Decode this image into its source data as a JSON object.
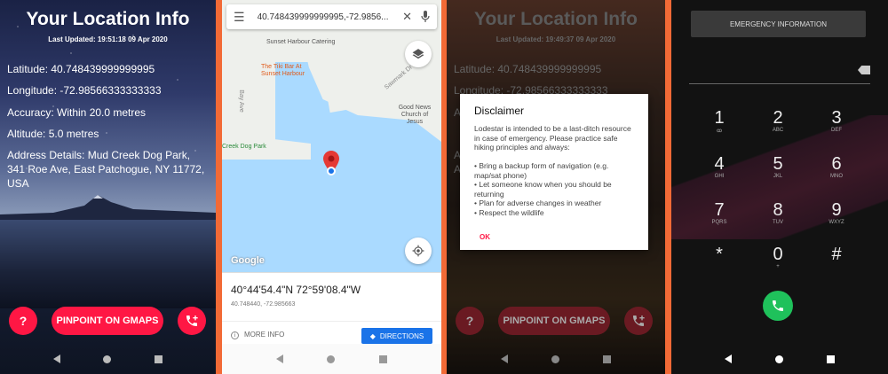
{
  "screen1": {
    "title": "Your Location Info",
    "last_updated": "Last Updated: 19:51:18 09 Apr 2020",
    "latitude": "Latitude: 40.748439999999995",
    "longitude": "Longitude: -72.98566333333333",
    "accuracy": "Accuracy: Within 20.0 metres",
    "altitude": "Altitude: 5.0 metres",
    "address": "Address Details: Mud Creek Dog Park, 341 Roe Ave, East Patchogue, NY 11772, USA",
    "help_label": "?",
    "pinpoint_label": "PINPOINT ON GMAPS"
  },
  "screen2": {
    "search_text": "40.748439999999995,-72.9856...",
    "labels": {
      "catering": "Sunset Harbour Catering",
      "tiki": "The Tiki Bar At Sunset Harbour",
      "church": "Good News Church of Jesus",
      "dogpark": "Creek Dog Park",
      "street1": "Bay Ave",
      "street2": "Sawmark Dr",
      "google": "Google"
    },
    "coord_dms": "40°44'54.4\"N 72°59'08.4\"W",
    "coord_dec": "40.748440, -72.985663",
    "more_info": "MORE INFO",
    "directions": "DIRECTIONS"
  },
  "screen3": {
    "title": "Your Location Info",
    "last_updated": "Last Updated: 19:49:37 09 Apr 2020",
    "latitude": "Latitude: 40.748439999999995",
    "longitude": "Longitude: -72.98566333333333",
    "partial_a": "A",
    "partial_b": "A",
    "partial_c": "A",
    "pinpoint_label": "PINPOINT ON GMAPS",
    "help_label": "?",
    "dialog": {
      "title": "Disclaimer",
      "body": "Lodestar is intended to be a last-ditch resource in case of emergency. Please practice safe hiking principles and always:\n\n• Bring a backup form of navigation (e.g. map/sat phone)\n• Let someone know when you should be returning\n• Plan for adverse changes in weather\n• Respect the wildlife",
      "ok": "OK"
    }
  },
  "screen4": {
    "emergency": "EMERGENCY INFORMATION",
    "keys": [
      {
        "d": "1",
        "l": "ꝏ"
      },
      {
        "d": "2",
        "l": "ABC"
      },
      {
        "d": "3",
        "l": "DEF"
      },
      {
        "d": "4",
        "l": "GHI"
      },
      {
        "d": "5",
        "l": "JKL"
      },
      {
        "d": "6",
        "l": "MNO"
      },
      {
        "d": "7",
        "l": "PQRS"
      },
      {
        "d": "8",
        "l": "TUV"
      },
      {
        "d": "9",
        "l": "WXYZ"
      },
      {
        "d": "*",
        "l": ""
      },
      {
        "d": "0",
        "l": "+"
      },
      {
        "d": "#",
        "l": ""
      }
    ]
  },
  "colors": {
    "accent": "#ff1744",
    "frame": "#f26a36",
    "call": "#1fc15b",
    "map_blue": "#1a73e8"
  }
}
